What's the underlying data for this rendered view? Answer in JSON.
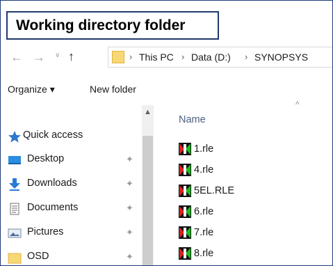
{
  "callout": {
    "title": "Working directory folder"
  },
  "address": {
    "crumbs": [
      "This PC",
      "Data (D:)",
      "SYNOPSYS"
    ]
  },
  "toolbar": {
    "organize_label": "Organize ▾",
    "new_folder_label": "New folder"
  },
  "nav": {
    "items": [
      {
        "label": "Quick access",
        "icon": "star-icon",
        "pinned": false
      },
      {
        "label": "Desktop",
        "icon": "desktop-icon",
        "pinned": true
      },
      {
        "label": "Downloads",
        "icon": "download-icon",
        "pinned": true
      },
      {
        "label": "Documents",
        "icon": "documents-icon",
        "pinned": true
      },
      {
        "label": "Pictures",
        "icon": "pictures-icon",
        "pinned": true
      },
      {
        "label": "OSD",
        "icon": "folder-icon",
        "pinned": true
      }
    ]
  },
  "files": {
    "column_name": "Name",
    "items": [
      "1.rle",
      "4.rle",
      "5EL.RLE",
      "6.rle",
      "7.rle",
      "8.rle"
    ]
  },
  "colors": {
    "accent": "#1f3a7a",
    "folder": "#f8d775",
    "star": "#2f77d0"
  }
}
